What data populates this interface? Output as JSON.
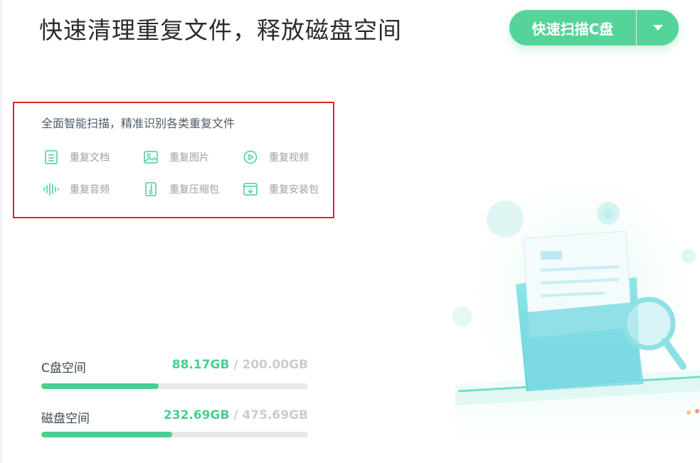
{
  "header": {
    "title": "快速清理重复文件，释放磁盘空间",
    "scan_button_label": "快速扫描C盘",
    "dropdown_icon": "caret-down-icon"
  },
  "features": {
    "description": "全面智能扫描，精准识别各类重复文件",
    "items": [
      {
        "label": "重复文档",
        "icon": "document-icon"
      },
      {
        "label": "重复图片",
        "icon": "image-icon"
      },
      {
        "label": "重复视频",
        "icon": "video-play-icon"
      },
      {
        "label": "重复音频",
        "icon": "audio-wave-icon"
      },
      {
        "label": "重复压缩包",
        "icon": "zip-archive-icon"
      },
      {
        "label": "重复安装包",
        "icon": "installer-package-icon"
      }
    ]
  },
  "storage": {
    "c_drive": {
      "label": "C盘空间",
      "used": "88.17GB",
      "separator": "/",
      "total": "200.00GB",
      "fill_fraction": 0.44
    },
    "disk": {
      "label": "磁盘空间",
      "used": "232.69GB",
      "separator": "/",
      "total": "475.69GB",
      "fill_fraction": 0.49
    }
  },
  "colors": {
    "accent": "#55d49a",
    "progress": "#47cf8f",
    "highlight_border": "#e0261f"
  }
}
